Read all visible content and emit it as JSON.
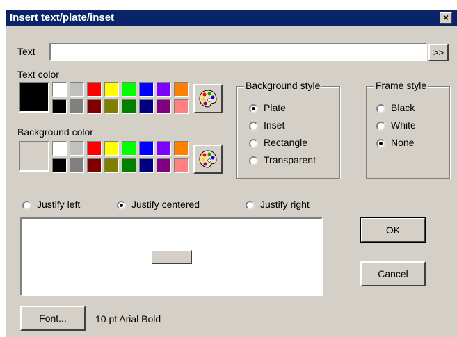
{
  "dialog": {
    "title": "Insert text/plate/inset",
    "close_label": "×"
  },
  "text_field": {
    "label": "Text",
    "value": "",
    "browse_label": ">>"
  },
  "text_color": {
    "label": "Text color",
    "selected": "#000000",
    "swatches_top": [
      "#ffffff",
      "#c0c0c0",
      "#ff0000",
      "#ffff00",
      "#00ff00",
      "#0000ff",
      "#8000ff",
      "#ff8000"
    ],
    "swatches_bottom": [
      "#000000",
      "#808080",
      "#800000",
      "#808000",
      "#008000",
      "#000080",
      "#800080",
      "#ff8080"
    ]
  },
  "background_color": {
    "label": "Background color",
    "selected": "#d4d0c8",
    "swatches_top": [
      "#ffffff",
      "#c0c0c0",
      "#ff0000",
      "#ffff00",
      "#00ff00",
      "#0000ff",
      "#8000ff",
      "#ff8000"
    ],
    "swatches_bottom": [
      "#000000",
      "#808080",
      "#800000",
      "#808000",
      "#008000",
      "#000080",
      "#800080",
      "#ff8080"
    ]
  },
  "background_style": {
    "label": "Background style",
    "options": [
      "Plate",
      "Inset",
      "Rectangle",
      "Transparent"
    ],
    "selected": "Plate"
  },
  "frame_style": {
    "label": "Frame style",
    "options": [
      "Black",
      "White",
      "None"
    ],
    "selected": "None"
  },
  "justify": {
    "options": [
      "Justify left",
      "Justify centered",
      "Justify right"
    ],
    "selected": "Justify centered"
  },
  "buttons": {
    "ok": "OK",
    "cancel": "Cancel",
    "font": "Font..."
  },
  "font_info": "10 pt Arial Bold"
}
